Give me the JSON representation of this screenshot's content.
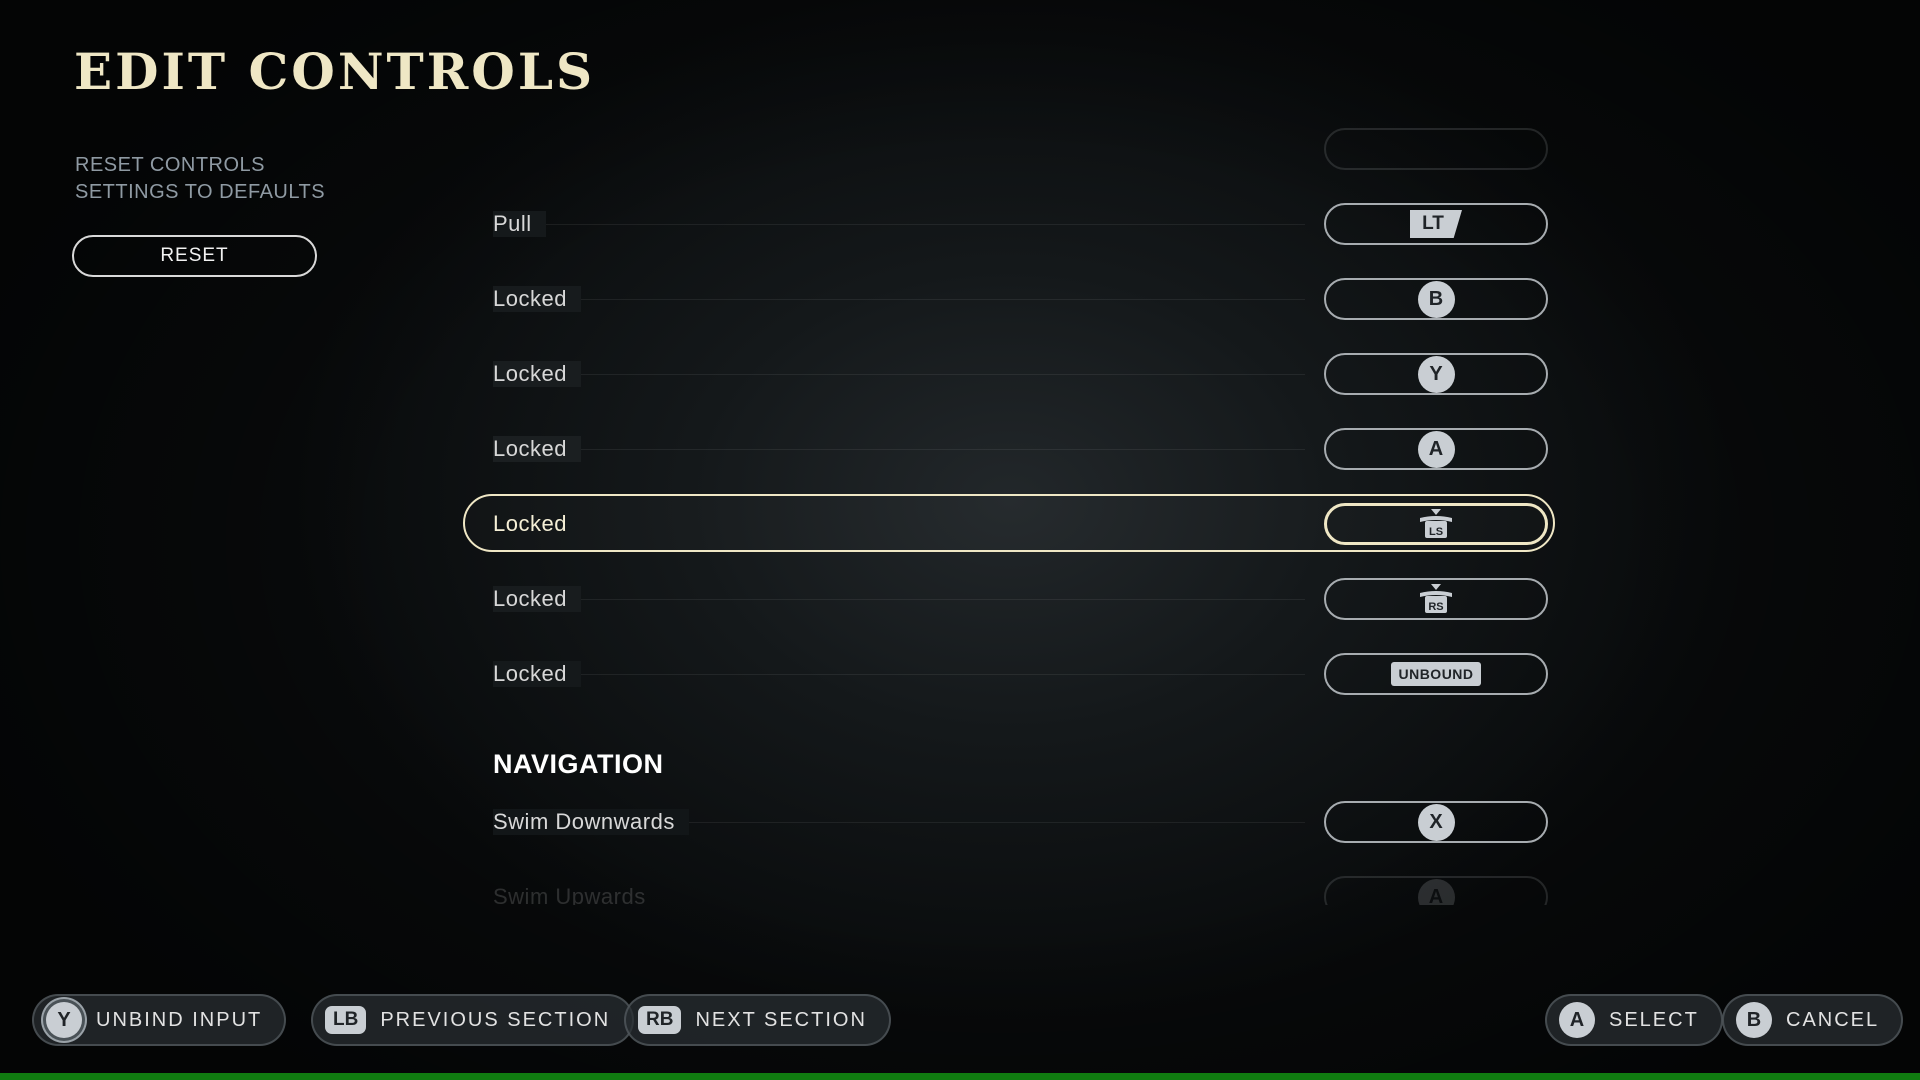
{
  "page": {
    "title": "EDIT CONTROLS"
  },
  "reset": {
    "description_line1": "RESET CONTROLS",
    "description_line2": "SETTINGS TO DEFAULTS",
    "button_label": "RESET"
  },
  "bindings": [
    {
      "label": "Pull",
      "button": "LT",
      "glyph": "trigger"
    },
    {
      "label": "Locked",
      "button": "B",
      "glyph": "round"
    },
    {
      "label": "Locked",
      "button": "Y",
      "glyph": "round"
    },
    {
      "label": "Locked",
      "button": "A",
      "glyph": "round"
    },
    {
      "label": "Locked",
      "button": "LS",
      "glyph": "stick",
      "selected": true
    },
    {
      "label": "Locked",
      "button": "RS",
      "glyph": "stick"
    },
    {
      "label": "Locked",
      "button": "UNBOUND",
      "glyph": "unbound"
    }
  ],
  "navigation": {
    "heading": "NAVIGATION",
    "bindings": [
      {
        "label": "Swim Downwards",
        "button": "X",
        "glyph": "round"
      },
      {
        "label": "Swim Upwards",
        "button": "A",
        "glyph": "round"
      }
    ]
  },
  "footer": {
    "unbind": {
      "button": "Y",
      "label": "UNBIND INPUT"
    },
    "prev": {
      "button": "LB",
      "label": "PREVIOUS SECTION"
    },
    "next": {
      "button": "RB",
      "label": "NEXT SECTION"
    },
    "select": {
      "button": "A",
      "label": "SELECT"
    },
    "cancel": {
      "button": "B",
      "label": "CANCEL"
    }
  },
  "colors": {
    "accent": "#efe7c5",
    "platform_bar": "#107c10",
    "glyph": "#c9ced3"
  },
  "icons": {
    "trigger": "left-trigger-icon",
    "stick": "thumbstick-icon",
    "round": "face-button-icon"
  }
}
